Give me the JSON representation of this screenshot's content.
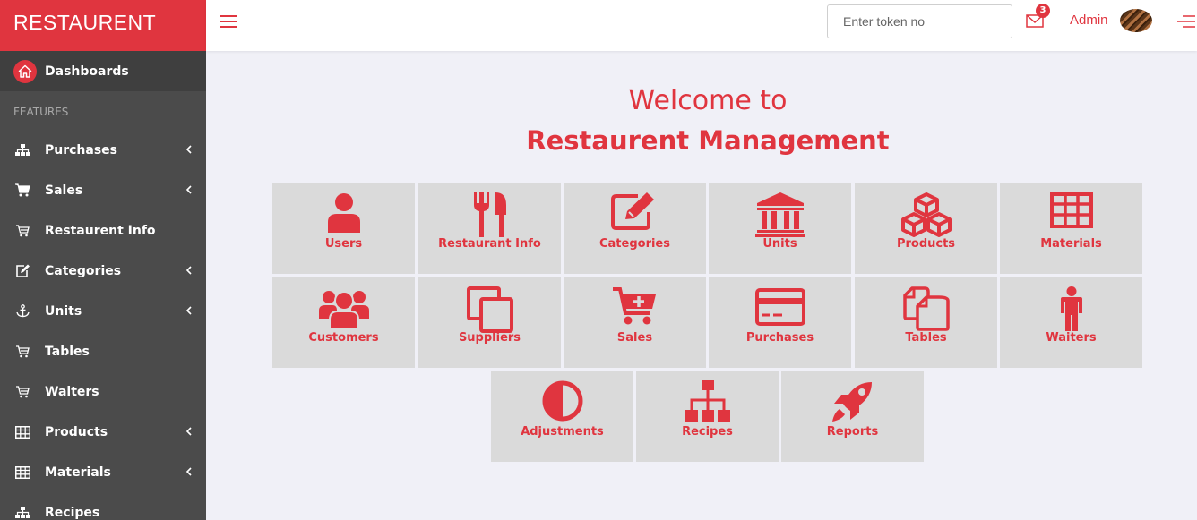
{
  "brand": "RESTAURENT",
  "sidebar": {
    "dashboard": "Dashboards",
    "section": "FEATURES",
    "items": [
      {
        "label": "Purchases",
        "icon": "sitemap-icon",
        "chevron": true
      },
      {
        "label": "Sales",
        "icon": "cart-icon",
        "chevron": true
      },
      {
        "label": "Restaurent Info",
        "icon": "cart-outline-icon",
        "chevron": false
      },
      {
        "label": "Categories",
        "icon": "edit-icon",
        "chevron": true
      },
      {
        "label": "Units",
        "icon": "anchor-icon",
        "chevron": true
      },
      {
        "label": "Tables",
        "icon": "cart-outline-icon",
        "chevron": false
      },
      {
        "label": "Waiters",
        "icon": "cart-outline-icon",
        "chevron": false
      },
      {
        "label": "Products",
        "icon": "table-icon",
        "chevron": true
      },
      {
        "label": "Materials",
        "icon": "table-icon",
        "chevron": true
      },
      {
        "label": "Recipes",
        "icon": "sitemap-icon",
        "chevron": false
      }
    ]
  },
  "header": {
    "token_placeholder": "Enter token no",
    "mail_count": "3",
    "user": "Admin"
  },
  "main": {
    "welcome": "Welcome to",
    "title": "Restaurent Management",
    "tiles": [
      {
        "label": "Users",
        "icon": "user-icon"
      },
      {
        "label": "Restaurant Info",
        "icon": "cutlery-icon"
      },
      {
        "label": "Categories",
        "icon": "edit-icon"
      },
      {
        "label": "Units",
        "icon": "bank-icon"
      },
      {
        "label": "Products",
        "icon": "cubes-icon"
      },
      {
        "label": "Materials",
        "icon": "table-icon"
      },
      {
        "label": "Customers",
        "icon": "users-icon"
      },
      {
        "label": "Suppliers",
        "icon": "copy-icon"
      },
      {
        "label": "Sales",
        "icon": "cart-plus-icon"
      },
      {
        "label": "Purchases",
        "icon": "credit-card-icon"
      },
      {
        "label": "Tables",
        "icon": "files-icon"
      },
      {
        "label": "Waiters",
        "icon": "male-icon"
      },
      {
        "label": "Adjustments",
        "icon": "adjust-icon"
      },
      {
        "label": "Recipes",
        "icon": "sitemap-icon"
      },
      {
        "label": "Reports",
        "icon": "rocket-icon"
      }
    ]
  },
  "colors": {
    "accent": "#e0353f",
    "sidebar": "#4b4b4b",
    "tile": "#dadada"
  }
}
